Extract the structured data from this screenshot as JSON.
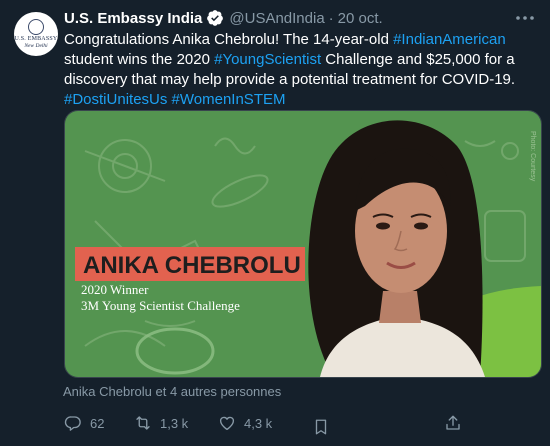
{
  "tweet": {
    "avatar_line1": "U.S. EMBASSY",
    "avatar_line2": "New Delhi",
    "author_name": "U.S. Embassy India",
    "handle": "@USAndIndia",
    "separator": "·",
    "date": "20 oct.",
    "text_1": "Congratulations Anika Chebrolu! The 14-year-old ",
    "tag_1": "#IndianAmerican",
    "text_2": " student wins the 2020 ",
    "tag_2": "#YoungScientist",
    "text_3": " Challenge and $25,000 for a discovery that may help provide a potential treatment for COVID-19.",
    "tag_3": "#DostiUnitesUs",
    "tag_4": "#WomenInSTEM"
  },
  "media": {
    "winner_name": "ANIKA CHEBROLU",
    "winner_line1": "2020 Winner",
    "winner_line2": "3M Young Scientist Challenge",
    "photo_credit": "Photo: Courtesy",
    "colors": {
      "green": "#4e8f4a",
      "banner": "#e2624f",
      "lime": "#7cc142"
    }
  },
  "tagged": "Anika Chebrolu et 4 autres personnes",
  "actions": {
    "replies": "62",
    "retweets": "1,3 k",
    "likes": "4,3 k"
  },
  "icons": [
    "verified-badge-icon",
    "more-options-icon",
    "reply-icon",
    "retweet-icon",
    "like-icon",
    "bookmark-icon",
    "share-icon"
  ]
}
